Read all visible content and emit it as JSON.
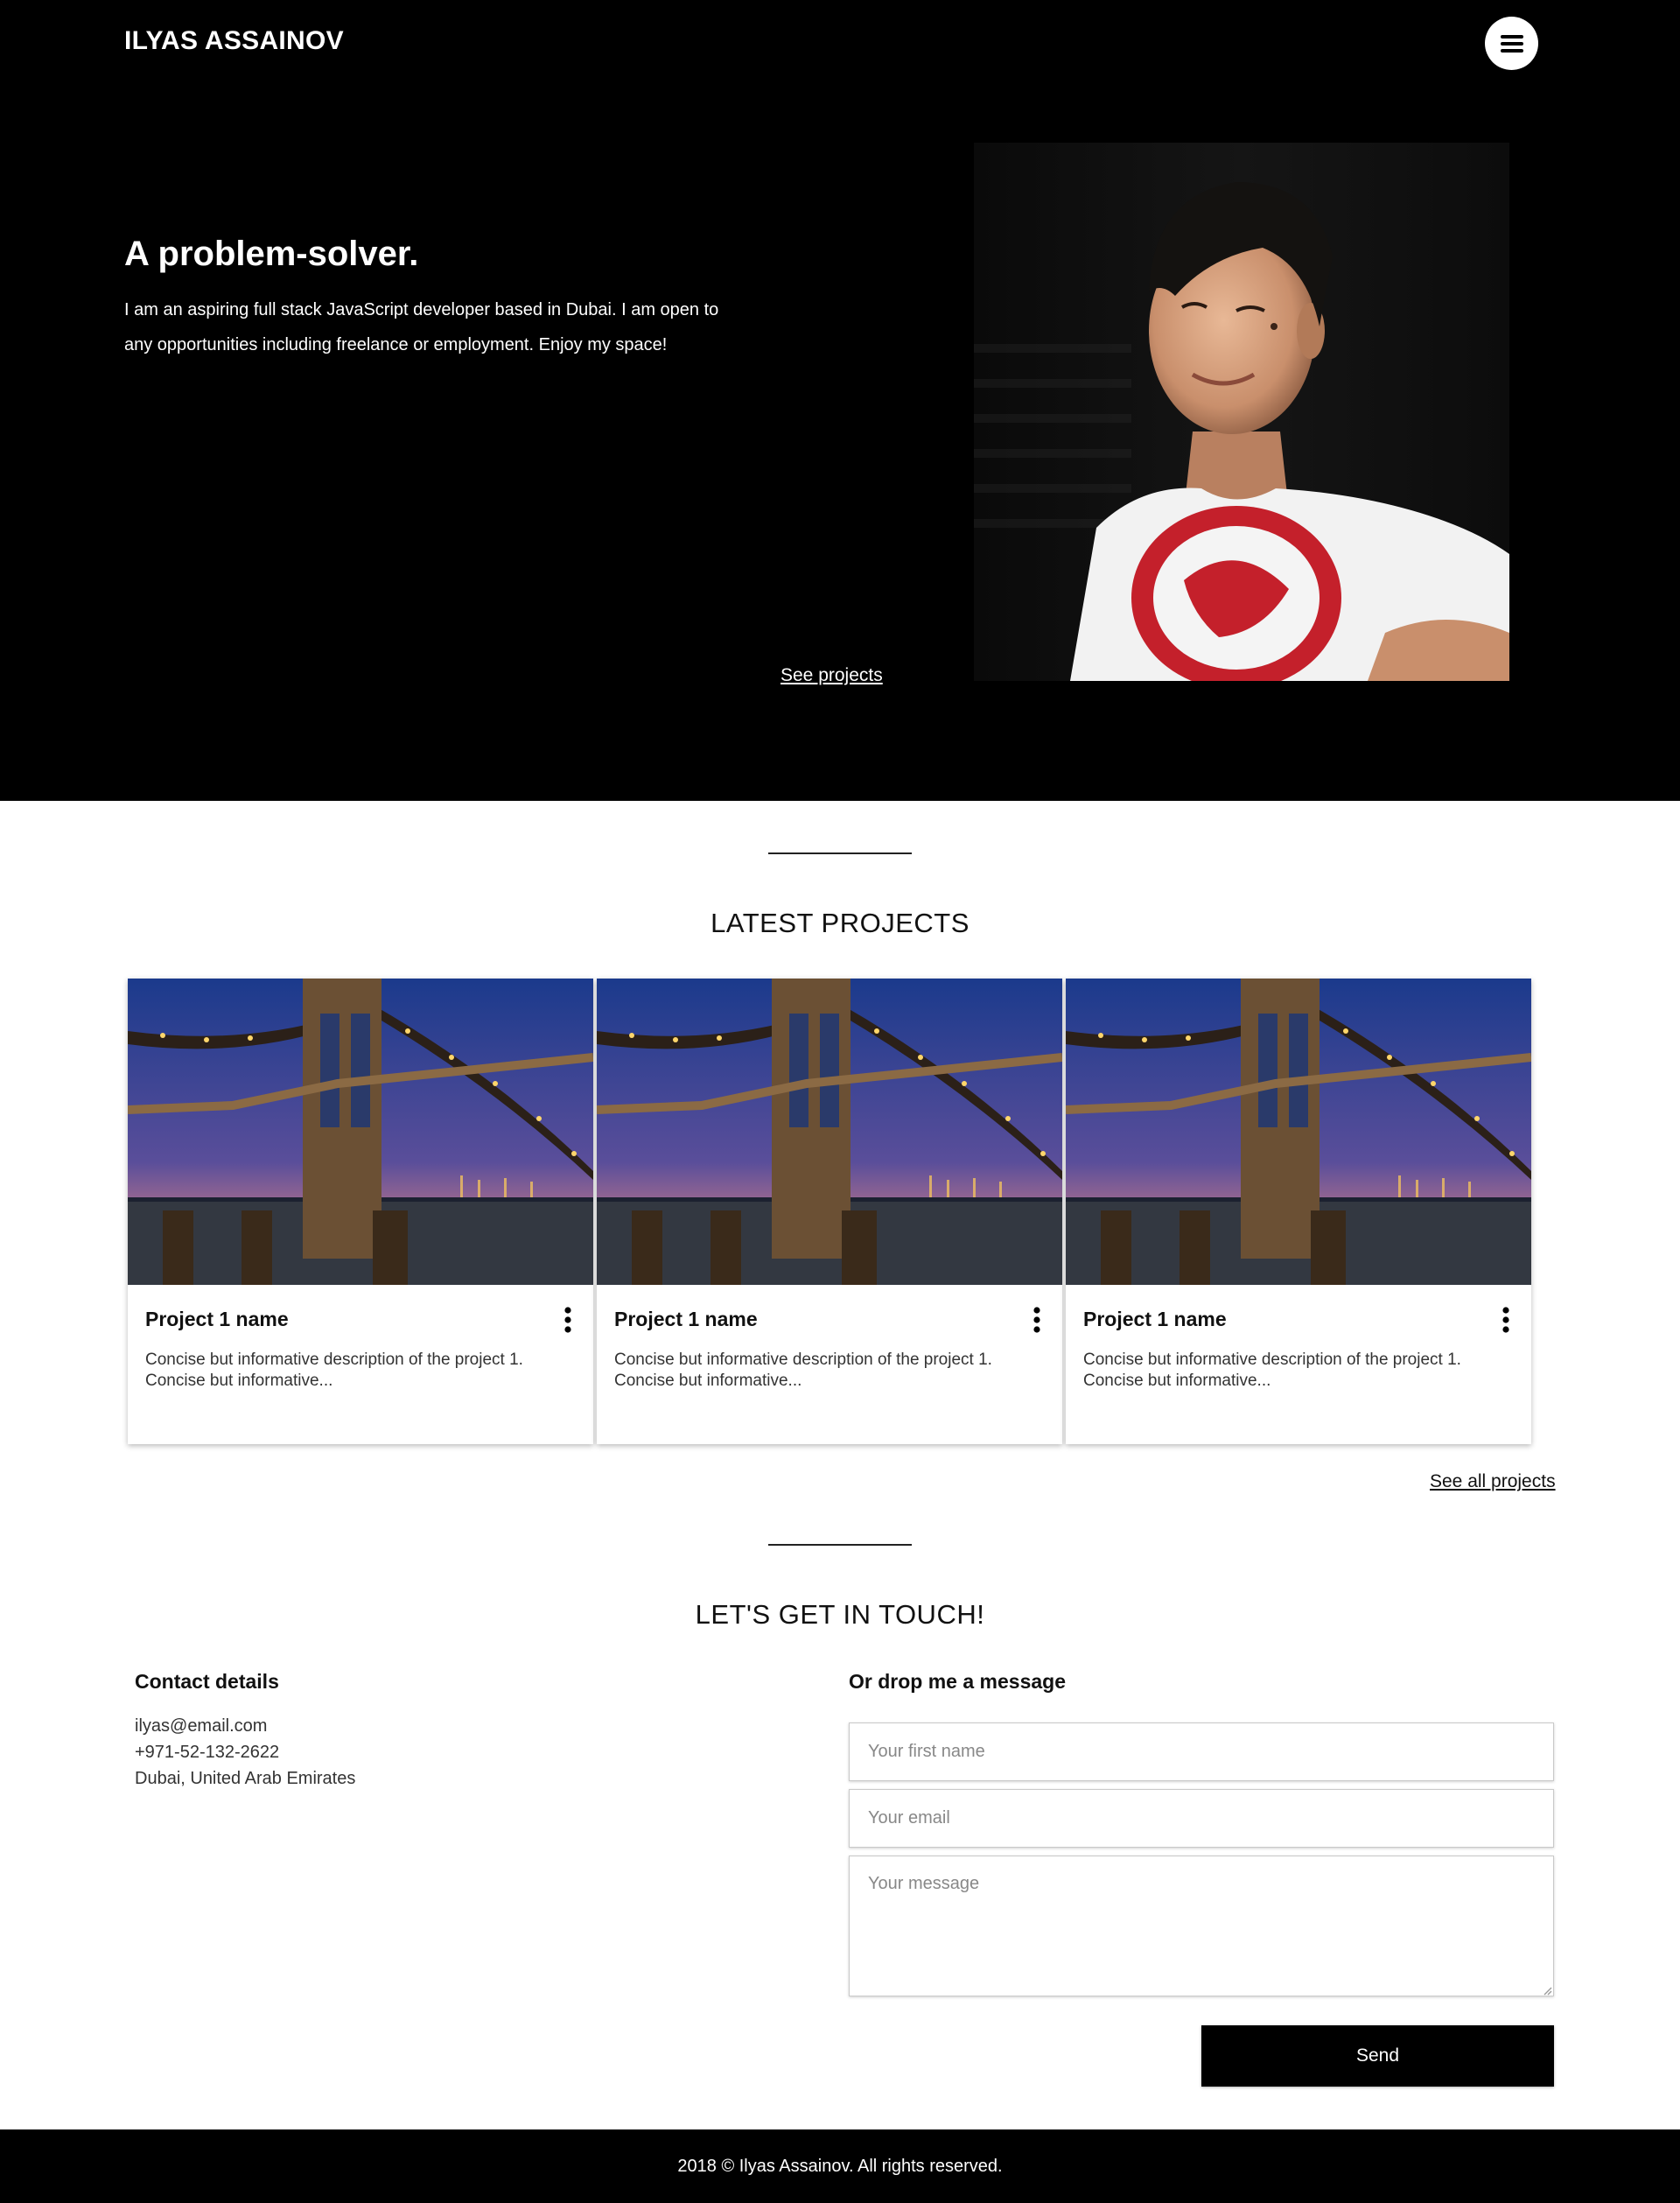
{
  "header": {
    "brand": "ILYAS ASSAINOV",
    "menu_icon": "hamburger-menu-icon"
  },
  "hero": {
    "title": "A problem-solver.",
    "text": "I am an aspiring full stack JavaScript developer based in Dubai. I am open to any opportunities including freelance or employment. Enjoy my space!",
    "see_projects": "See projects"
  },
  "projects": {
    "heading": "LATEST PROJECTS",
    "items": [
      {
        "name": "Project 1 name",
        "description": "Concise but informative description of the project 1. Concise but informative..."
      },
      {
        "name": "Project 1 name",
        "description": "Concise but informative description of the project 1. Concise but informative..."
      },
      {
        "name": "Project 1 name",
        "description": "Concise but informative description of the project 1. Concise but informative..."
      }
    ],
    "more_icon": "more-vertical-icon",
    "see_all": "See all projects"
  },
  "contact": {
    "heading": "LET'S GET IN TOUCH!",
    "details_title": "Contact details",
    "email": "ilyas@email.com",
    "phone": "+971-52-132-2622",
    "location": "Dubai, United Arab Emirates",
    "form_title": "Or drop me a message",
    "first_name_placeholder": "Your first name",
    "email_placeholder": "Your email",
    "message_placeholder": "Your message",
    "send_label": "Send"
  },
  "footer": {
    "text": "2018 © Ilyas Assainov. All rights reserved."
  },
  "colors": {
    "hero_bg": "#000000",
    "page_bg": "#ffffff",
    "button_bg": "#000000",
    "footer_bg": "#000000"
  }
}
